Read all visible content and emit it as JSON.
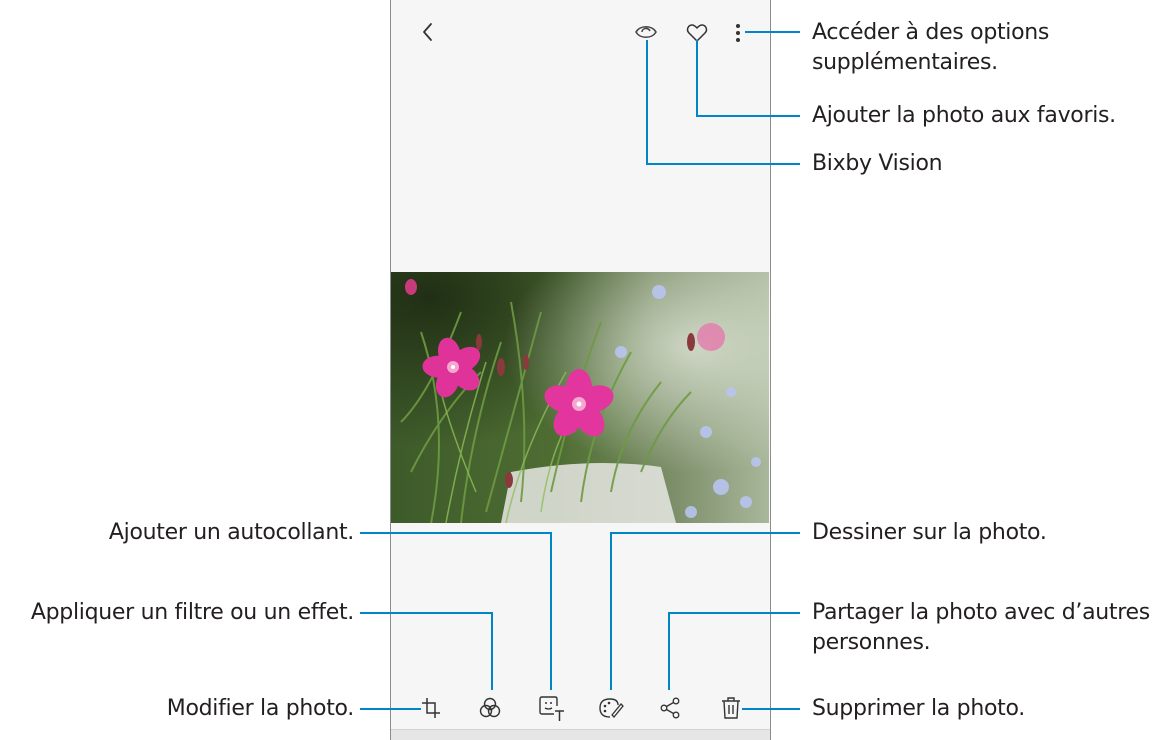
{
  "screen": {
    "back_icon": "chevron-left-icon",
    "top_actions": [
      "bixby-vision-icon",
      "heart-icon",
      "more-options-icon"
    ],
    "bottom_actions": [
      "edit-crop-icon",
      "filter-icon",
      "sticker-icon",
      "draw-icon",
      "share-icon",
      "delete-icon"
    ],
    "photo": "pink-dianthus-flowers"
  },
  "callouts": {
    "more_options": "Accéder à des options\nsupplémentaires.",
    "favorite": "Ajouter la photo aux favoris.",
    "bixby": "Bixby Vision",
    "sticker": "Ajouter un autocollant.",
    "draw": "Dessiner sur la photo.",
    "filter": "Appliquer un filtre ou un effet.",
    "share": "Partager la photo avec d’autres\npersonnes.",
    "edit": "Modifier la photo.",
    "delete": "Supprimer la photo."
  },
  "colors": {
    "line": "#0086c8",
    "text": "#231f20",
    "screen_bg": "#f6f6f6"
  }
}
